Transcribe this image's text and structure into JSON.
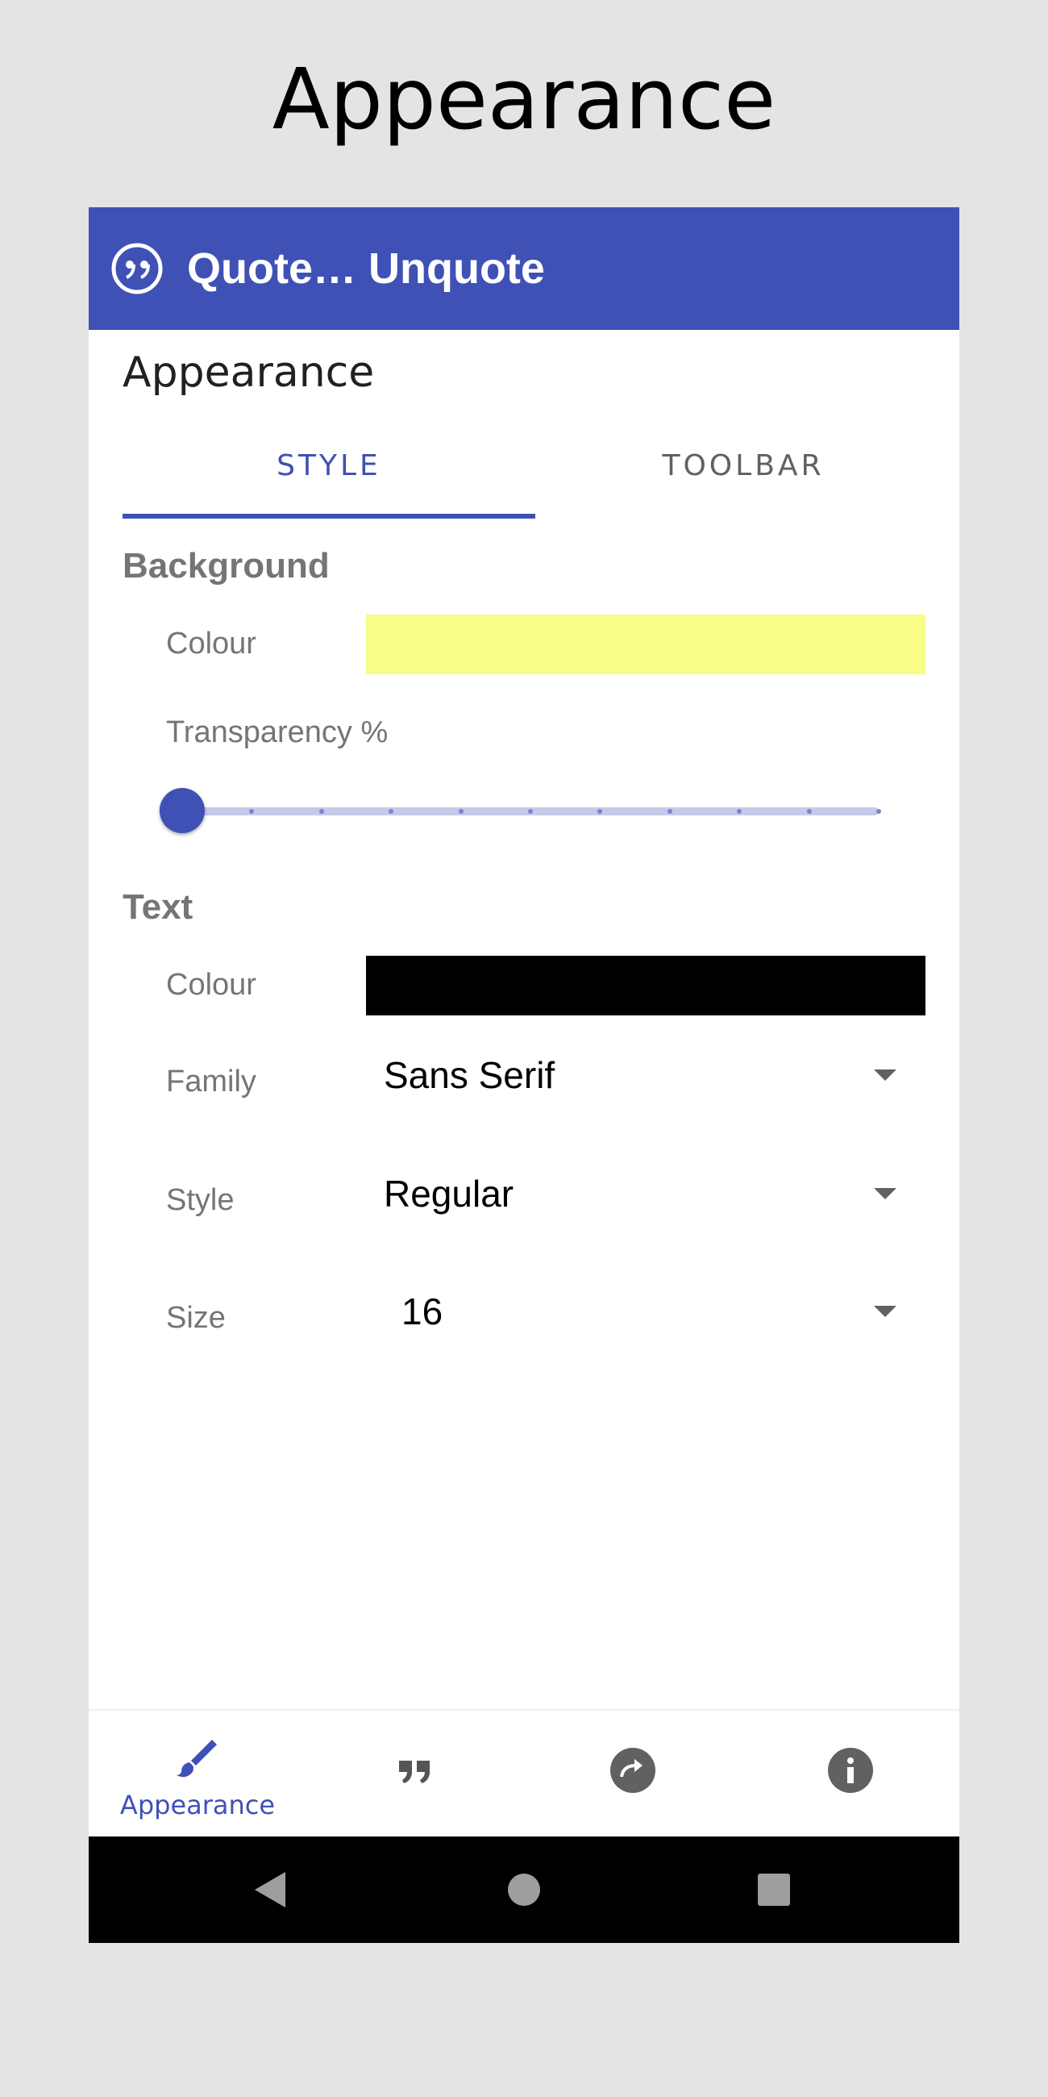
{
  "page_heading": "Appearance",
  "app_bar": {
    "title": "Quote… Unquote",
    "icon": "quote-circle-icon",
    "color": "#3f51b5"
  },
  "screen_title": "Appearance",
  "tabs": [
    {
      "label": "STYLE",
      "selected": true
    },
    {
      "label": "TOOLBAR",
      "selected": false
    }
  ],
  "background": {
    "section_label": "Background",
    "colour_label": "Colour",
    "colour_value": "#f7fd87",
    "transparency_label": "Transparency %",
    "transparency_value": 0,
    "transparency_steps": 11
  },
  "text": {
    "section_label": "Text",
    "colour_label": "Colour",
    "colour_value": "#000000",
    "family_label": "Family",
    "family_value": "Sans Serif",
    "style_label": "Style",
    "style_value": "Regular",
    "size_label": "Size",
    "size_value": "16"
  },
  "bottom_nav": [
    {
      "icon": "paintbrush-icon",
      "label": "Appearance",
      "selected": true
    },
    {
      "icon": "quote-icon",
      "label": "",
      "selected": false
    },
    {
      "icon": "refresh-icon",
      "label": "",
      "selected": false
    },
    {
      "icon": "info-icon",
      "label": "",
      "selected": false
    }
  ],
  "system_nav": [
    "back-icon",
    "home-icon",
    "recents-icon"
  ],
  "colors": {
    "accent": "#3f51b5",
    "slider_track": "#c5cae9"
  }
}
